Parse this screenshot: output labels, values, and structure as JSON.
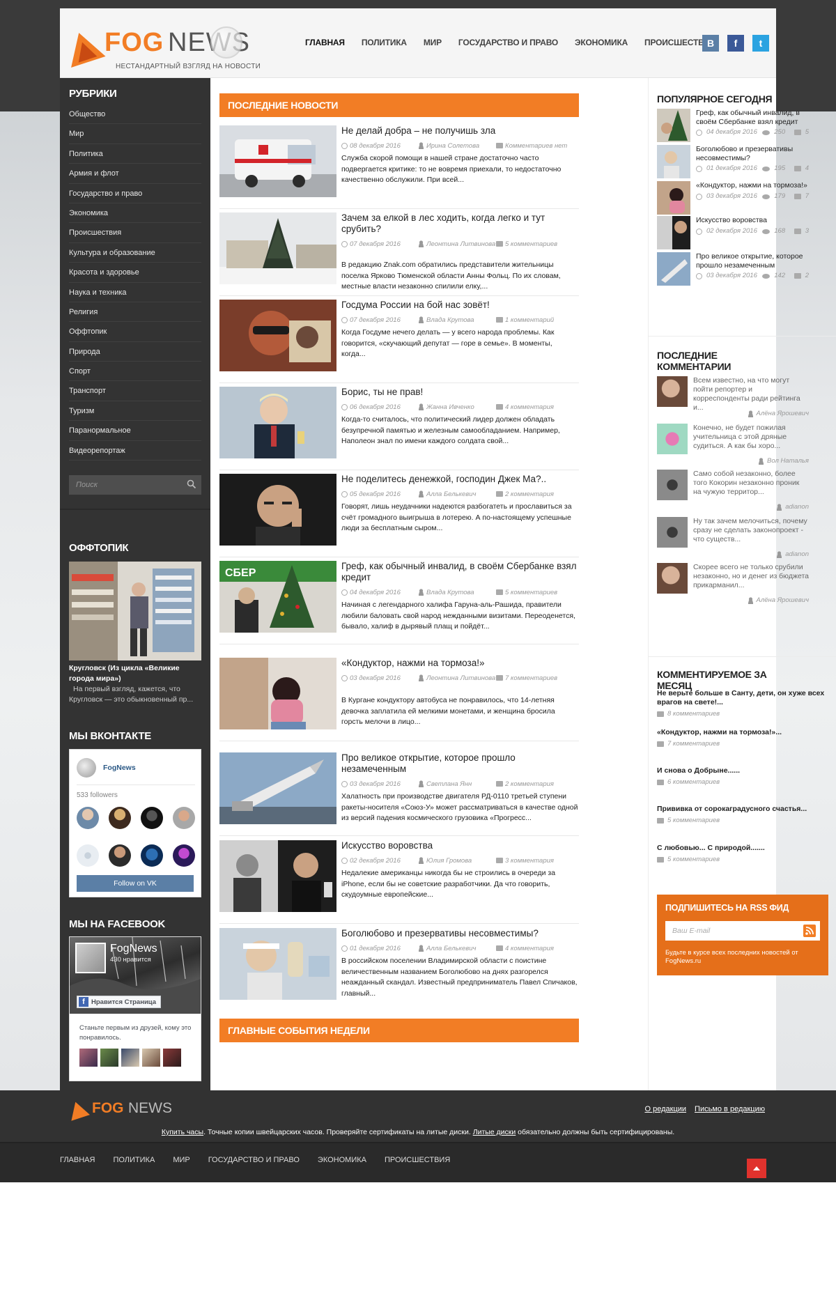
{
  "header": {
    "logo_fog": "FOG",
    "logo_news": "NEWS",
    "tagline": "НЕСТАНДАРТНЫЙ ВЗГЛЯД НА НОВОСТИ",
    "nav": [
      "ГЛАВНАЯ",
      "ПОЛИТИКА",
      "МИР",
      "ГОСУДАРСТВО И ПРАВО",
      "ЭКОНОМИКА",
      "ПРОИСШЕСТВИЯ"
    ],
    "social": [
      {
        "name": "vk-icon",
        "glyph": "B",
        "color": "#5b7fa6"
      },
      {
        "name": "facebook-icon",
        "glyph": "f",
        "color": "#3b5998"
      },
      {
        "name": "twitter-icon",
        "glyph": "t",
        "color": "#2ba3e1"
      }
    ]
  },
  "left": {
    "rubrics_title": "РУБРИКИ",
    "rubrics": [
      "Общество",
      "Мир",
      "Политика",
      "Армия и флот",
      "Государство и право",
      "Экономика",
      "Происшествия",
      "Культура и образование",
      "Красота и здоровье",
      "Наука и техника",
      "Религия",
      "Оффтопик",
      "Природа",
      "Спорт",
      "Транспорт",
      "Туризм",
      "Паранормальное",
      "Видеорепортаж"
    ],
    "search_placeholder": "Поиск",
    "offtopic_title": "ОФФТОПИК",
    "offtopic_caption": "Кругловск (Из цикла «Великие города мира»)",
    "offtopic_text": "На первый взгляд, кажется, что Кругловск — это обыкновенный пр...",
    "vk_title": "МЫ ВКОНТАКТЕ",
    "vk_name": "FogNews",
    "vk_followers": "533 followers",
    "vk_button": "Follow on VK",
    "fb_title": "МЫ НА FACEBOOK",
    "fb_name": "FogNews",
    "fb_likes": "430 нравится",
    "fb_button": "Нравится Страница",
    "fb_text": "Станьте первым из друзей, кому это понравилось."
  },
  "center": {
    "latest_title": "ПОСЛЕДНИЕ НОВОСТИ",
    "week_title": "ГЛАВНЫЕ СОБЫТИЯ НЕДЕЛИ",
    "articles": [
      {
        "title": "Не делай добра – не получишь зла",
        "date": "08 декабря 2016",
        "author": "Ирина Солетова",
        "comments": "Комментариев нет",
        "excerpt": "Служба скорой помощи в нашей стране достаточно часто подвергается критике: то не вовремя приехали, то недостаточно качественно обслужили. При всей..."
      },
      {
        "title": "Зачем за елкой в лес ходить, когда легко и тут срубить?",
        "date": "07 декабря 2016",
        "author": "Леонтина Литвинова",
        "comments": "5 комментариев",
        "excerpt": "В редакцию Znak.com обратились представители жительницы поселка Ярково Тюменской области Анны Фольц. По их словам, местные власти незаконно спилили елку,..."
      },
      {
        "title": "Госдума России на бой нас зовёт!",
        "date": "07 декабря 2016",
        "author": "Влада Крутова",
        "comments": "1 комментарий",
        "excerpt": "Когда Госдуме нечего делать — у всего народа проблемы. Как говорится, «скучающий депутат — горе в семье». В моменты, когда..."
      },
      {
        "title": "Борис, ты не прав!",
        "date": "06 декабря 2016",
        "author": "Жанна Ивченко",
        "comments": "4 комментария",
        "excerpt": "Когда-то считалось, что политический лидер должен обладать безупречной памятью и железным самообладанием. Например, Наполеон знал по имени каждого солдата свой..."
      },
      {
        "title": "Не поделитесь денежкой, господин Джек Ма?..",
        "date": "05 декабря 2016",
        "author": "Алла Белькевич",
        "comments": "2 комментария",
        "excerpt": "Говорят, лишь неудачники надеются разбогатеть и прославиться за счёт громадного выигрыша в лотерею. А по-настоящему успешные люди за бесплатным сыром..."
      },
      {
        "title": "Греф, как обычный инвалид, в своём Сбербанке взял кредит",
        "date": "04 декабря 2016",
        "author": "Влада Крутова",
        "comments": "5 комментариев",
        "excerpt": "Начиная с легендарного халифа Гаруна-аль-Рашида, правители любили баловать свой народ нежданными визитами. Переоденется, бывало, халиф в дырявый плащ и пойдёт..."
      },
      {
        "title": "«Кондуктор, нажми на тормоза!»",
        "date": "03 декабря 2016",
        "author": "Леонтина Литвинова",
        "comments": "7 комментариев",
        "excerpt": "В Кургане кондуктору автобуса не понравилось, что 14-летняя девочка заплатила ей мелкими монетами, и женщина бросила горсть мелочи в лицо..."
      },
      {
        "title": "Про великое открытие, которое прошло незамеченным",
        "date": "03 декабря 2016",
        "author": "Светлана Янн",
        "comments": "2 комментария",
        "excerpt": "Халатность при производстве двигателя РД-0110 третьей ступени ракеты-носителя «Союз-У» может рассматриваться в качестве одной из версий падения космического грузовика «Прогресс..."
      },
      {
        "title": "Искусство воровства",
        "date": "02 декабря 2016",
        "author": "Юлия Громова",
        "comments": "3 комментария",
        "excerpt": "Недалекие американцы никогда бы не строились в очереди за iPhone, если бы не советские разработчики. Да что говорить, скудоумные европейские..."
      },
      {
        "title": "Боголюбово и презервативы несовместимы?",
        "date": "01 декабря 2016",
        "author": "Алла Белькевич",
        "comments": "4 комментария",
        "excerpt": "В российском поселении Владимирской области с поистине величественным названием Боголюбово на днях разгорелся неажданный скандал. Известный предприниматель Павел Спичаков, главный..."
      }
    ]
  },
  "right": {
    "popular_title": "ПОПУЛЯРНОЕ СЕГОДНЯ",
    "popular": [
      {
        "title": "Греф, как обычный инвалид, в своём Сбербанке взял кредит",
        "date": "04 декабря 2016",
        "views": "250",
        "comments": "5"
      },
      {
        "title": "Боголюбово и презервативы несовместимы?",
        "date": "01 декабря 2016",
        "views": "195",
        "comments": "4"
      },
      {
        "title": "«Кондуктор, нажми на тормоза!»",
        "date": "03 декабря 2016",
        "views": "179",
        "comments": "7"
      },
      {
        "title": "Искусство воровства",
        "date": "02 декабря 2016",
        "views": "168",
        "comments": "3"
      },
      {
        "title": "Про великое открытие, которое прошло незамеченным",
        "date": "03 декабря 2016",
        "views": "142",
        "comments": "2"
      }
    ],
    "comments_title": "ПОСЛЕДНИЕ КОММЕНТАРИИ",
    "comments": [
      {
        "text": "Всем известно, на что могут пойти репортер и корреспонденты ради рейтинга и...",
        "author": "Алёна Ярошевич"
      },
      {
        "text": "Конечно, не будет пожилая учительница с этой дряные судиться. А как бы хоро...",
        "author": "Вол Наталья"
      },
      {
        "text": "Само собой незаконно, более того Кокорин незаконно проник на чужую территор...",
        "author": "adianon"
      },
      {
        "text": "Ну так зачем мелочиться, почему сразу не сделать законопроект - что существ...",
        "author": "adianon"
      },
      {
        "text": "Скорее всего не только срубили незаконно, но и денег из бюджета прикарманил...",
        "author": "Алёна Ярошевич"
      }
    ],
    "top_title": "КОММЕНТИРУЕМОЕ ЗА МЕСЯЦ",
    "top": [
      {
        "title": "Не верьте больше в Санту, дети, он хуже всех врагов на свете!...",
        "count": "8 комментариев"
      },
      {
        "title": "«Кондуктор, нажми на тормоза!»...",
        "count": "7 комментариев"
      },
      {
        "title": "И снова о Добрыне......",
        "count": "6 комментариев"
      },
      {
        "title": "Прививка от сорокаградусного счастья...",
        "count": "5 комментариев"
      },
      {
        "title": "С любовью... С природой.......",
        "count": "5 комментариев"
      }
    ],
    "rss_title": "ПОДПИШИТЕСЬ НА RSS ФИД",
    "rss_placeholder": "Ваш E-mail",
    "rss_text": "Будьте в курсе всех последних новостей от FogNews.ru"
  },
  "footer": {
    "logo_fog": "FOG",
    "logo_news": "NEWS",
    "link_about": "О редакции",
    "link_letter": "Письмо в редакцию",
    "ad_link1": "Купить часы",
    "ad_text1": ". Точные копии швейцарских часов. Проверяйте сертификаты на литые диски. ",
    "ad_link2": "Литые диски",
    "ad_text2": " обязательно должны быть сертифицированы.",
    "nav": [
      "ГЛАВНАЯ",
      "ПОЛИТИКА",
      "МИР",
      "ГОСУДАРСТВО И ПРАВО",
      "ЭКОНОМИКА",
      "ПРОИСШЕСТВИЯ"
    ]
  }
}
